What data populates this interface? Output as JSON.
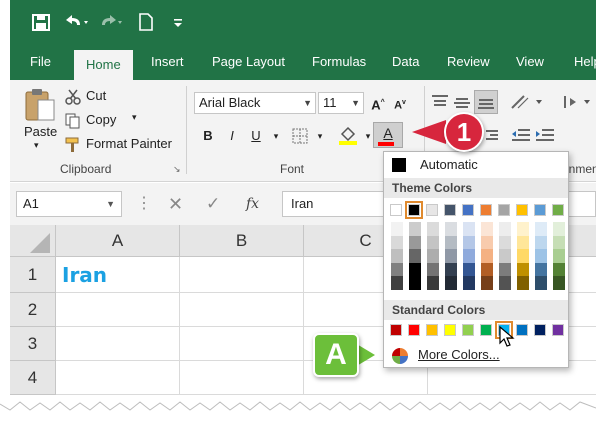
{
  "quick_access": {
    "icons": [
      "save-icon",
      "undo-icon",
      "redo-icon",
      "new-file-icon",
      "customize-icon"
    ]
  },
  "tabs": [
    "File",
    "Home",
    "Insert",
    "Page Layout",
    "Formulas",
    "Data",
    "Review",
    "View",
    "Help"
  ],
  "ribbon": {
    "clipboard": {
      "paste": "Paste",
      "cut": "Cut",
      "copy": "Copy",
      "format_painter": "Format Painter",
      "group_label": "Clipboard"
    },
    "font": {
      "font_name": "Arial Black",
      "font_size": "11",
      "grow": "A",
      "shrink": "A",
      "bold": "B",
      "italic": "I",
      "underline": "U",
      "font_color_letter": "A",
      "group_label": "Font"
    },
    "alignment": {
      "group_label_partial": "gnment"
    }
  },
  "formula_bar": {
    "name_box": "A1",
    "fx": "fx",
    "value": "Iran"
  },
  "grid": {
    "columns": [
      "A",
      "B",
      "C"
    ],
    "rows": [
      "1",
      "2",
      "3",
      "4"
    ],
    "cell_a1": "Iran"
  },
  "color_dropdown": {
    "automatic": "Automatic",
    "theme_header": "Theme Colors",
    "standard_header": "Standard Colors",
    "more_colors": "More Colors...",
    "theme_colors": [
      "#ffffff",
      "#000000",
      "#e7e6e6",
      "#44546a",
      "#4472c4",
      "#ed7d31",
      "#a5a5a5",
      "#ffc000",
      "#5b9bd5",
      "#70ad47"
    ],
    "standard_colors": [
      "#c00000",
      "#ff0000",
      "#ffc000",
      "#ffff00",
      "#92d050",
      "#00b050",
      "#00b0f0",
      "#0070c0",
      "#002060",
      "#7030a0"
    ],
    "selected_standard_index": 6
  },
  "callouts": {
    "step_1": "1",
    "step_a": "A"
  }
}
